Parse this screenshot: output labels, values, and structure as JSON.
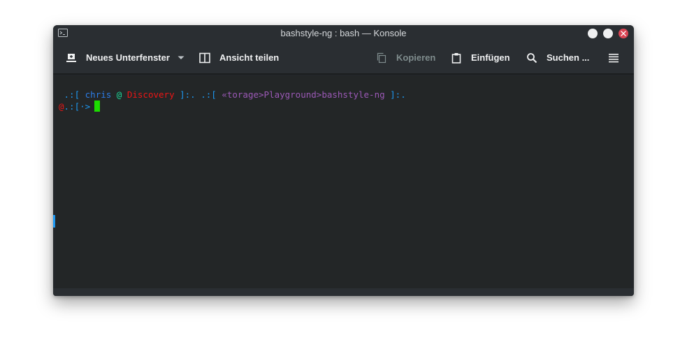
{
  "window": {
    "title": "bashstyle-ng : bash — Konsole"
  },
  "toolbar": {
    "new_tab_label": "Neues Unterfenster",
    "split_view_label": "Ansicht teilen",
    "copy_label": "Kopieren",
    "paste_label": "Einfügen",
    "find_label": "Suchen ..."
  },
  "terminal": {
    "line1": {
      "open_bracket": " .:[ ",
      "user": "chris",
      "at": " @ ",
      "host": "Discovery",
      "close_sep": " ]:. .:[ ",
      "path": "«torage>Playground>bashstyle-ng",
      "close_bracket": " ]:."
    },
    "line2": {
      "prefix": "@",
      "prompt": ".:[·>"
    }
  },
  "colors": {
    "terminal_bg": "#232627",
    "prompt_cyan": "#1d99f3",
    "user_blue": "#2c7de8",
    "at_green": "#1cdc9a",
    "host_red": "#ed1515",
    "path_purple": "#9b59b6",
    "cursor_green": "#1cdc00",
    "close_button": "#da4453"
  },
  "icons": {
    "app": "terminal-icon",
    "new_tab": "new-tab-icon",
    "dropdown": "chevron-down-icon",
    "split": "split-view-icon",
    "copy": "copy-icon",
    "paste": "paste-icon",
    "find": "search-icon",
    "menu": "hamburger-menu-icon"
  }
}
